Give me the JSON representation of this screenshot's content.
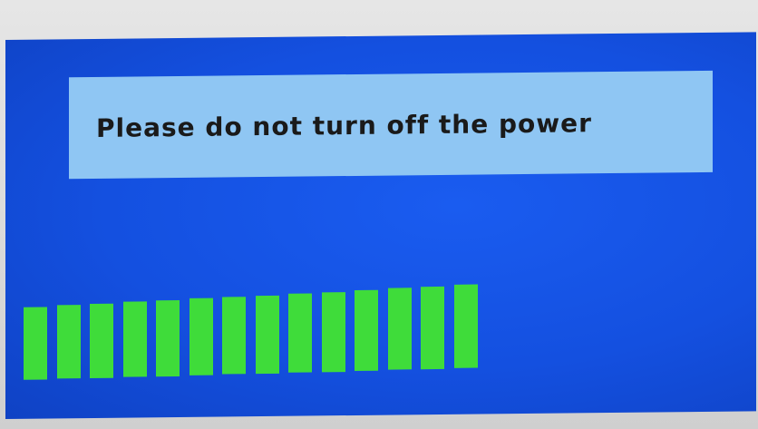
{
  "dialog": {
    "message": "Please do not turn off the power"
  },
  "progress": {
    "filled_segments": 14,
    "fill_color": "#3fdc3a"
  },
  "colors": {
    "screen_background": "#1450e0",
    "message_box": "#8fc6f3"
  }
}
